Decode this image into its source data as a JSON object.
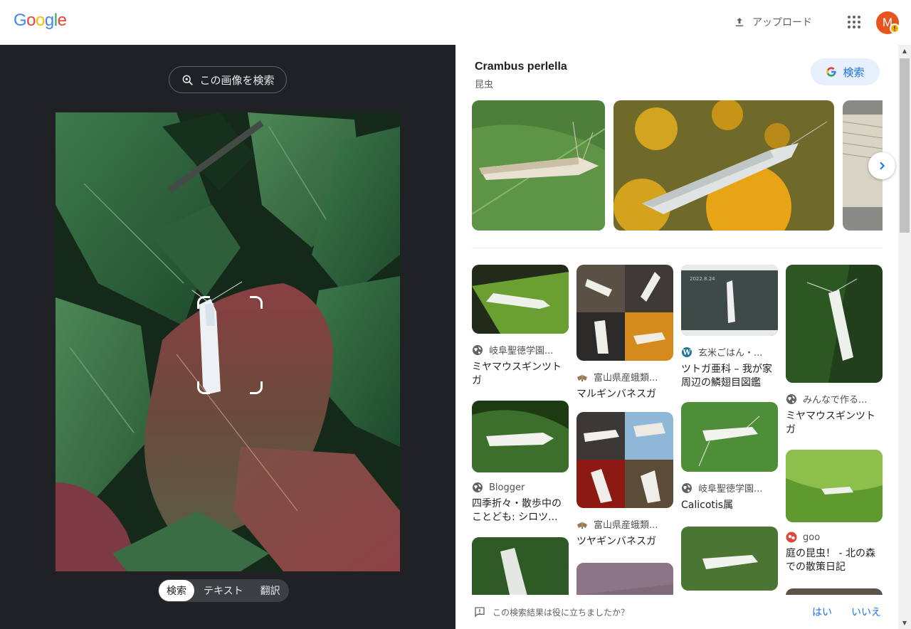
{
  "header": {
    "logo_letters": [
      {
        "ch": "G",
        "color": "#4285f4"
      },
      {
        "ch": "o",
        "color": "#ea4335"
      },
      {
        "ch": "o",
        "color": "#fbbc05"
      },
      {
        "ch": "g",
        "color": "#4285f4"
      },
      {
        "ch": "l",
        "color": "#34a853"
      },
      {
        "ch": "e",
        "color": "#ea4335"
      }
    ],
    "upload_label": "アップロード",
    "avatar_letter": "M",
    "avatar_badge": "!"
  },
  "left": {
    "search_image_label": "この画像を検索",
    "tabs": [
      {
        "label": "検索",
        "active": true
      },
      {
        "label": "テキスト",
        "active": false
      },
      {
        "label": "翻訳",
        "active": false
      }
    ]
  },
  "knowledge": {
    "title": "Crambus perlella",
    "subtitle": "昆虫",
    "search_label": "検索"
  },
  "results": {
    "columns": [
      [
        {
          "source": "岐阜聖徳学園...",
          "icon": "globe-icon",
          "title": "ミヤマウスギンツトガ"
        },
        {
          "source": "Blogger",
          "icon": "globe-icon",
          "title": "四季折々・散歩中のことども: シロツ..."
        },
        {
          "source": "",
          "icon": "",
          "title": ""
        }
      ],
      [
        {
          "source": "富山県産蛾類...",
          "icon": "moth-icon",
          "title": "マルギンバネスガ"
        },
        {
          "source": "富山県産蛾類...",
          "icon": "moth-icon",
          "title": "ツヤギンバネスガ"
        },
        {
          "source": "",
          "icon": "",
          "title": ""
        }
      ],
      [
        {
          "source": "玄米ごはん・...",
          "icon": "wordpress-icon",
          "title": "ツトガ亜科 – 我が家周辺の鱗翅目図鑑"
        },
        {
          "source": "岐阜聖徳学園...",
          "icon": "globe-icon",
          "title": "Calicotis属"
        },
        {
          "source": "",
          "icon": "",
          "title": ""
        }
      ],
      [
        {
          "source": "みんなで作る...",
          "icon": "globe-icon",
          "title": "ミヤマウスギンツトガ"
        },
        {
          "source": "goo",
          "icon": "goo-icon",
          "title": "庭の昆虫！ - 北の森での散策日記"
        },
        {
          "source": "",
          "icon": "",
          "title": ""
        }
      ]
    ],
    "thumb_date": "2022.8.24"
  },
  "feedback": {
    "question": "この検索結果は役に立ちましたか？",
    "yes": "はい",
    "no": "いいえ"
  },
  "colors": {
    "accent": "#1a73e8",
    "dark_bg": "#202124",
    "avatar": "#e8541e"
  }
}
